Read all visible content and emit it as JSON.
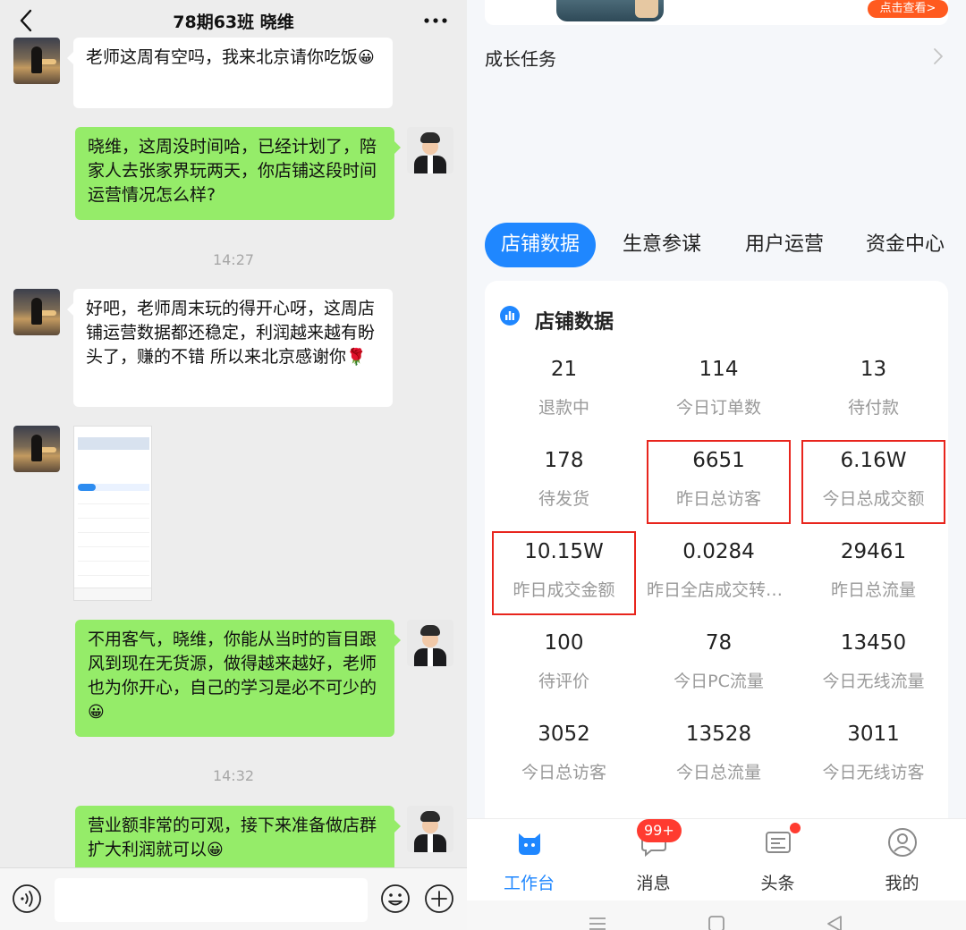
{
  "chat": {
    "title": "78期63班 晓维",
    "messages": [
      {
        "side": "left",
        "text": "老师这周有空吗，我来北京请你吃饭",
        "emoji": "😀"
      },
      {
        "side": "right",
        "text": "晓维，这周没时间哈，已经计划了，陪家人去张家界玩两天，你店铺这段时间运营情况怎么样?"
      },
      {
        "side": "left",
        "text": "好吧，老师周末玩的得开心呀，这周店铺运营数据都还稳定，利润越来越有盼头了，赚的不错 所以来北京感谢你",
        "emoji": "🌹"
      },
      {
        "side": "right",
        "text": "不用客气，晓维，你能从当时的盲目跟风到现在无货源，做得越来越好，老师也为你开心，自己的学习是必不可少的",
        "emoji": "😀"
      },
      {
        "side": "right",
        "text": "营业额非常的可观，接下来准备做店群扩大利润就可以",
        "emoji": "😀"
      }
    ],
    "timestamps": [
      "14:27",
      "14:32"
    ],
    "input": {
      "placeholder": "",
      "value": ""
    }
  },
  "store": {
    "banner_button": "点击查看>",
    "growth_task": "成长任务",
    "tabs": [
      "店铺数据",
      "生意参谋",
      "用户运营",
      "资金中心"
    ],
    "active_tab": 0,
    "card_title": "店铺数据",
    "metrics": [
      {
        "value": "21",
        "label": "退款中",
        "highlighted": false
      },
      {
        "value": "114",
        "label": "今日订单数",
        "highlighted": false
      },
      {
        "value": "13",
        "label": "待付款",
        "highlighted": false
      },
      {
        "value": "178",
        "label": "待发货",
        "highlighted": false
      },
      {
        "value": "6651",
        "label": "昨日总访客",
        "highlighted": true
      },
      {
        "value": "6.16W",
        "label": "今日总成交额",
        "highlighted": true
      },
      {
        "value": "10.15W",
        "label": "昨日成交金额",
        "highlighted": true
      },
      {
        "value": "0.0284",
        "label": "昨日全店成交转化率",
        "highlighted": false
      },
      {
        "value": "29461",
        "label": "昨日总流量",
        "highlighted": false
      },
      {
        "value": "100",
        "label": "待评价",
        "highlighted": false
      },
      {
        "value": "78",
        "label": "今日PC流量",
        "highlighted": false
      },
      {
        "value": "13450",
        "label": "今日无线流量",
        "highlighted": false
      },
      {
        "value": "3052",
        "label": "今日总访客",
        "highlighted": false
      },
      {
        "value": "13528",
        "label": "今日总流量",
        "highlighted": false
      },
      {
        "value": "3011",
        "label": "今日无线访客",
        "highlighted": false
      }
    ],
    "nav": [
      {
        "label": "工作台",
        "icon": "workbench-icon",
        "active": true
      },
      {
        "label": "消息",
        "icon": "message-icon",
        "badge": "99+"
      },
      {
        "label": "头条",
        "icon": "news-icon",
        "dot": true
      },
      {
        "label": "我的",
        "icon": "profile-icon"
      }
    ],
    "accent_color": "#1f87ff",
    "highlight_color": "#e8251d"
  }
}
